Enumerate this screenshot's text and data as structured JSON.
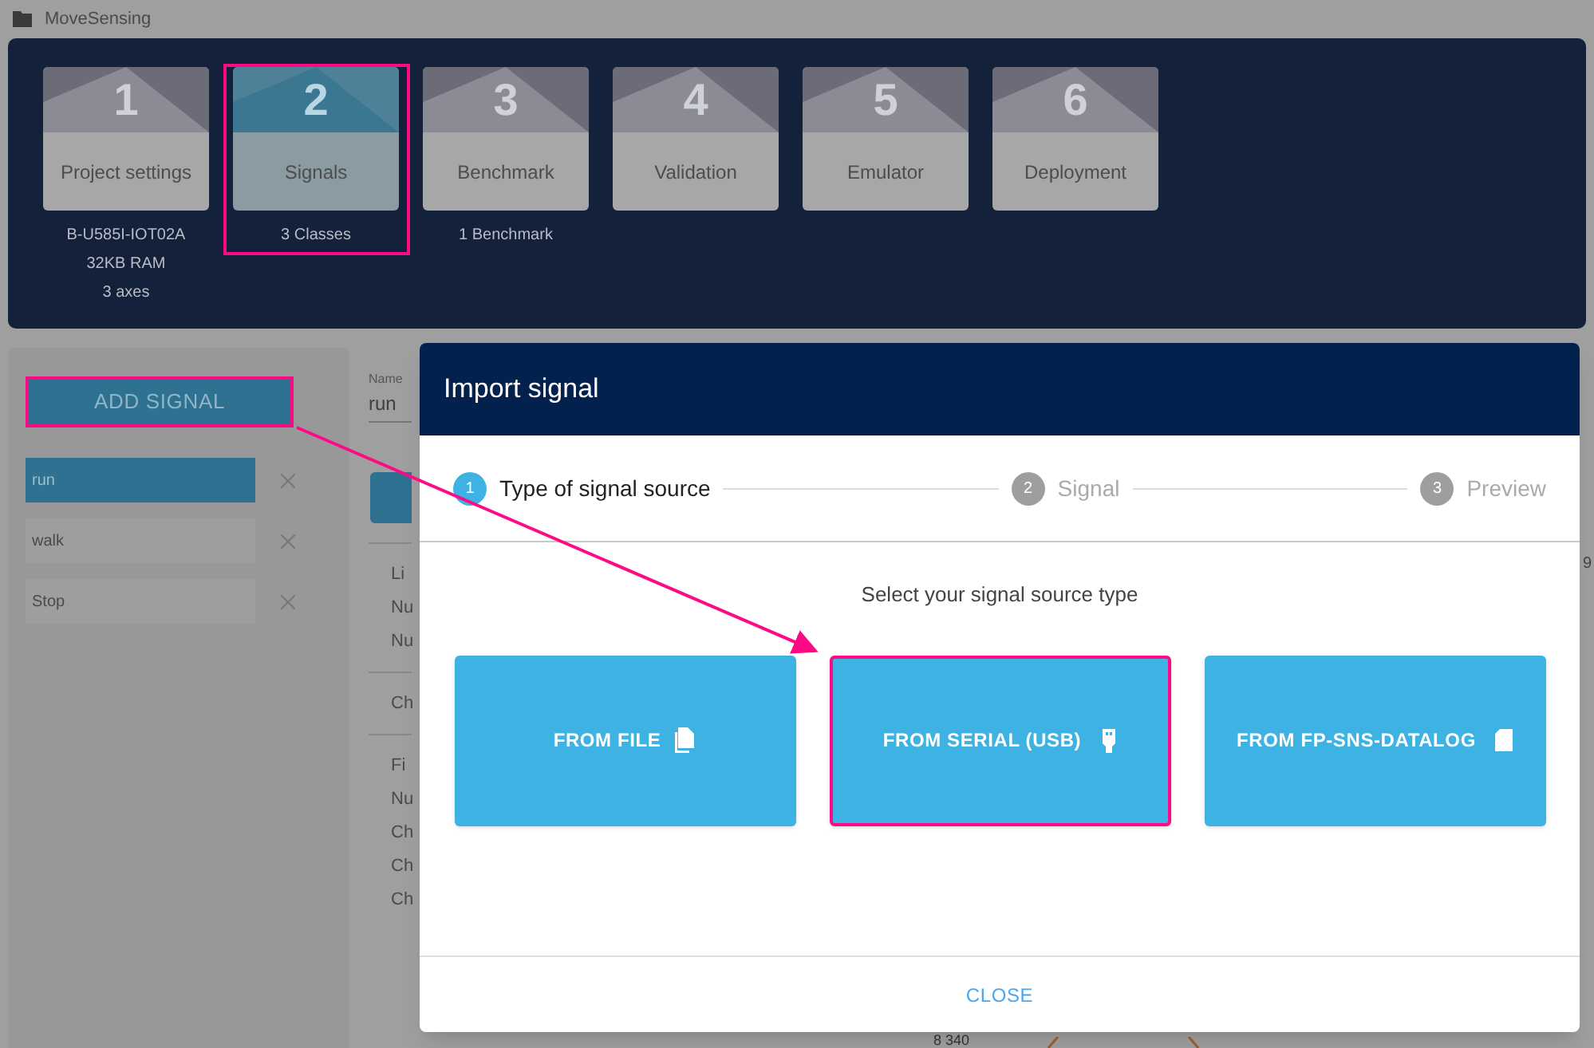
{
  "app_title": "MoveSensing",
  "steps": [
    {
      "number": "1",
      "label": "Project settings",
      "selected": false,
      "highlighted": false,
      "details": [
        "B-U585I-IOT02A",
        "32KB RAM",
        "3 axes"
      ]
    },
    {
      "number": "2",
      "label": "Signals",
      "selected": true,
      "highlighted": true,
      "details": [
        "3 Classes"
      ]
    },
    {
      "number": "3",
      "label": "Benchmark",
      "selected": false,
      "highlighted": false,
      "details": [
        "1 Benchmark"
      ]
    },
    {
      "number": "4",
      "label": "Validation",
      "selected": false,
      "highlighted": false
    },
    {
      "number": "5",
      "label": "Emulator",
      "selected": false,
      "highlighted": false
    },
    {
      "number": "6",
      "label": "Deployment",
      "selected": false,
      "highlighted": false
    }
  ],
  "sidebar": {
    "add_button": {
      "label": "ADD SIGNAL",
      "highlighted": true
    },
    "signals": [
      {
        "name": "run",
        "selected": true
      },
      {
        "name": "walk",
        "selected": false
      },
      {
        "name": "Stop",
        "selected": false
      }
    ]
  },
  "detail_panel": {
    "name_label": "Name",
    "name_value": "run",
    "groups": [
      [
        "Li",
        "Nu",
        "Nu"
      ],
      [
        "Ch"
      ],
      [
        "Fi",
        "Nu",
        "Ch",
        "Ch",
        "Ch"
      ]
    ]
  },
  "chart_edge": {
    "tick_label": "8 340",
    "column_label": "9"
  },
  "dialog": {
    "title": "Import signal",
    "steps": [
      {
        "number": "1",
        "label": "Type of signal source",
        "selected": true
      },
      {
        "number": "2",
        "label": "Signal",
        "selected": false
      },
      {
        "number": "3",
        "label": "Preview",
        "selected": false
      }
    ],
    "prompt": "Select your signal source type",
    "sources": [
      {
        "label": "FROM FILE",
        "kind": "file",
        "highlighted": false
      },
      {
        "label": "FROM SERIAL (USB)",
        "kind": "usb",
        "highlighted": true
      },
      {
        "label": "FROM FP-SNS-DATALOG",
        "kind": "sd",
        "highlighted": false
      }
    ],
    "close": "CLOSE"
  }
}
